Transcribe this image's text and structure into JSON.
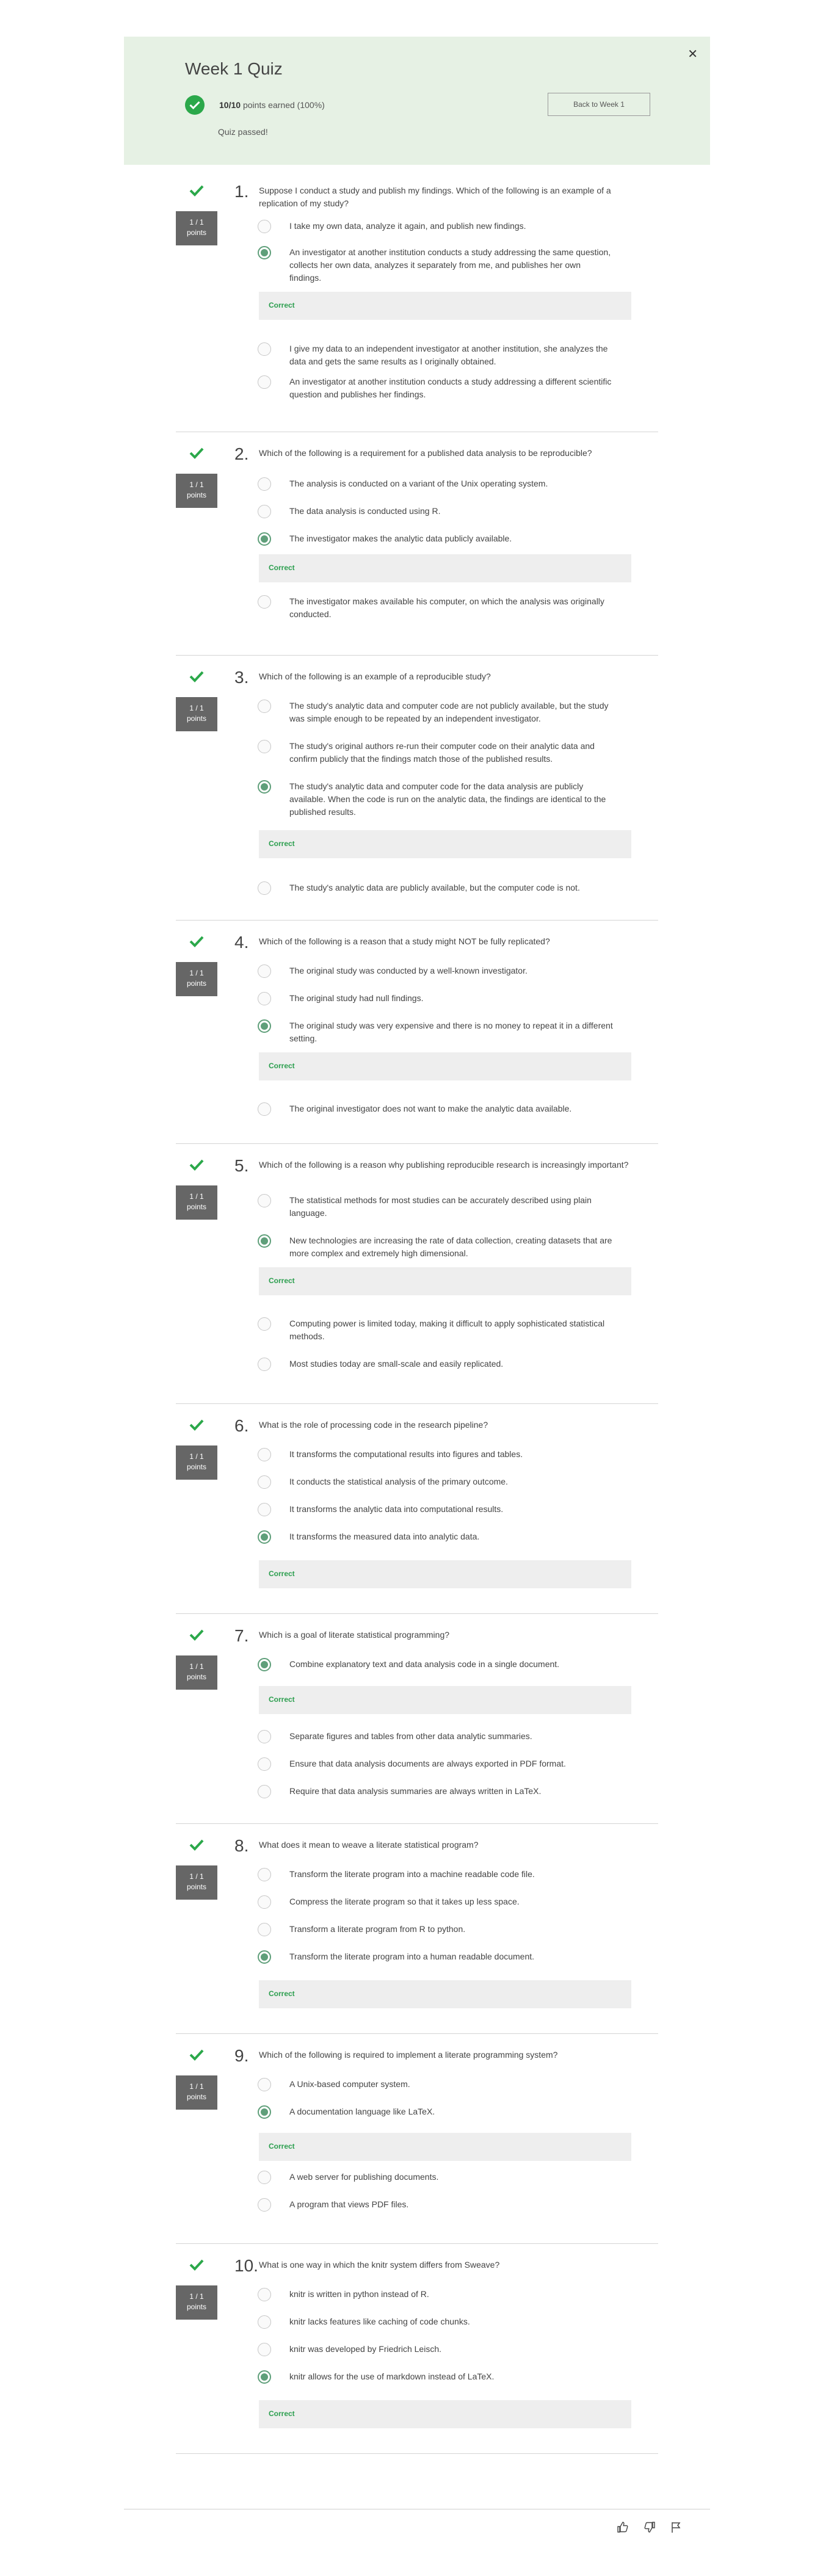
{
  "header": {
    "title": "Week 1 Quiz",
    "score": "10/10",
    "score_suffix": "points earned (100%)",
    "back_label": "Back to Week 1",
    "status": "Quiz passed!",
    "close_icon": "close-icon"
  },
  "correct_label": "Correct",
  "questions": [
    {
      "num": "1.",
      "points": "1 / 1",
      "points_label": "points",
      "text": "Suppose I conduct a study and publish my findings. Which of the following is an example of a replication of my study?",
      "options": [
        "I take my own data, analyze it again, and publish new findings.",
        "An investigator at another institution conducts a study addressing the same question, collects her own data, analyzes it separately from me, and publishes her own findings.",
        "I give my data to an independent investigator at another institution, she analyzes the data and gets the same results as I originally obtained.",
        "An investigator at another institution conducts a study addressing a different scientific question and publishes her findings."
      ],
      "selected": 1
    },
    {
      "num": "2.",
      "points": "1 / 1",
      "points_label": "points",
      "text": "Which of the following is a requirement for a published data analysis to be reproducible?",
      "options": [
        "The analysis is conducted on a variant of the Unix operating system.",
        "The data analysis is conducted using R.",
        "The investigator makes the analytic data publicly available.",
        "The investigator makes available his computer, on which the analysis was originally conducted."
      ],
      "selected": 2
    },
    {
      "num": "3.",
      "points": "1 / 1",
      "points_label": "points",
      "text": "Which of the following is an example of a reproducible study?",
      "options": [
        "The study's analytic data and computer code are not publicly available, but the study was simple enough to be repeated by an independent investigator.",
        "The study's original authors re-run their computer code on their analytic data and confirm publicly that the findings match those of the published results.",
        "The study's analytic data and computer code for the data analysis are publicly available. When the code is run on the analytic data, the findings are identical to the published results.",
        "The study's analytic data are publicly available, but the computer code is not."
      ],
      "selected": 2
    },
    {
      "num": "4.",
      "points": "1 / 1",
      "points_label": "points",
      "text": "Which of the following is a reason that a study might NOT be fully replicated?",
      "options": [
        "The original study was conducted by a well-known investigator.",
        "The original study had null findings.",
        "The original study was very expensive and there is no money to repeat it in a different setting.",
        "The original investigator does not want to make the analytic data available."
      ],
      "selected": 2
    },
    {
      "num": "5.",
      "points": "1 / 1",
      "points_label": "points",
      "text": "Which of the following is a reason why publishing reproducible research is increasingly important?",
      "options": [
        "The statistical methods for most studies can be accurately described using plain language.",
        "New technologies are increasing the rate of data collection, creating datasets that are more complex and extremely high dimensional.",
        "Computing power is limited today, making it difficult to apply sophisticated statistical methods.",
        "Most studies today are small-scale and easily replicated."
      ],
      "selected": 1
    },
    {
      "num": "6.",
      "points": "1 / 1",
      "points_label": "points",
      "text": "What is the role of processing code in the research pipeline?",
      "options": [
        "It transforms the computational results into figures and tables.",
        "It conducts the statistical analysis of the primary outcome.",
        "It transforms the analytic data into computational results.",
        "It transforms the measured data into analytic data."
      ],
      "selected": 3
    },
    {
      "num": "7.",
      "points": "1 / 1",
      "points_label": "points",
      "text": "Which is a goal of literate statistical programming?",
      "options": [
        "Combine explanatory text and data analysis code in a single document.",
        "Separate figures and tables from other data analytic summaries.",
        "Ensure that data analysis documents are always exported in PDF format.",
        "Require that data analysis summaries are always written in LaTeX."
      ],
      "selected": 0
    },
    {
      "num": "8.",
      "points": "1 / 1",
      "points_label": "points",
      "text": "What does it mean to weave a literate statistical program?",
      "options": [
        "Transform the literate program into a machine readable code file.",
        "Compress the literate program so that it takes up less space.",
        "Transform a literate program from R to python.",
        "Transform the literate program into a human readable document."
      ],
      "selected": 3
    },
    {
      "num": "9.",
      "points": "1 / 1",
      "points_label": "points",
      "text": "Which of the following is required to implement a literate programming system?",
      "options": [
        "A Unix-based computer system.",
        "A documentation language like LaTeX.",
        "A web server for publishing documents.",
        "A program that views PDF files."
      ],
      "selected": 1
    },
    {
      "num": "10.",
      "points": "1 / 1",
      "points_label": "points",
      "text": "What is one way in which the knitr system differs from Sweave?",
      "options": [
        "knitr is written in python instead of R.",
        "knitr lacks features like caching of code chunks.",
        "knitr was developed by Friedrich Leisch.",
        "knitr allows for the use of markdown instead of LaTeX."
      ],
      "selected": 3
    }
  ],
  "footer": {
    "icons": [
      "thumbs-up-icon",
      "thumbs-down-icon",
      "flag-icon"
    ]
  },
  "colors": {
    "accent": "#2ba84a",
    "banner": "#e6f1e4",
    "radio_selected": "#5f9f7a"
  }
}
